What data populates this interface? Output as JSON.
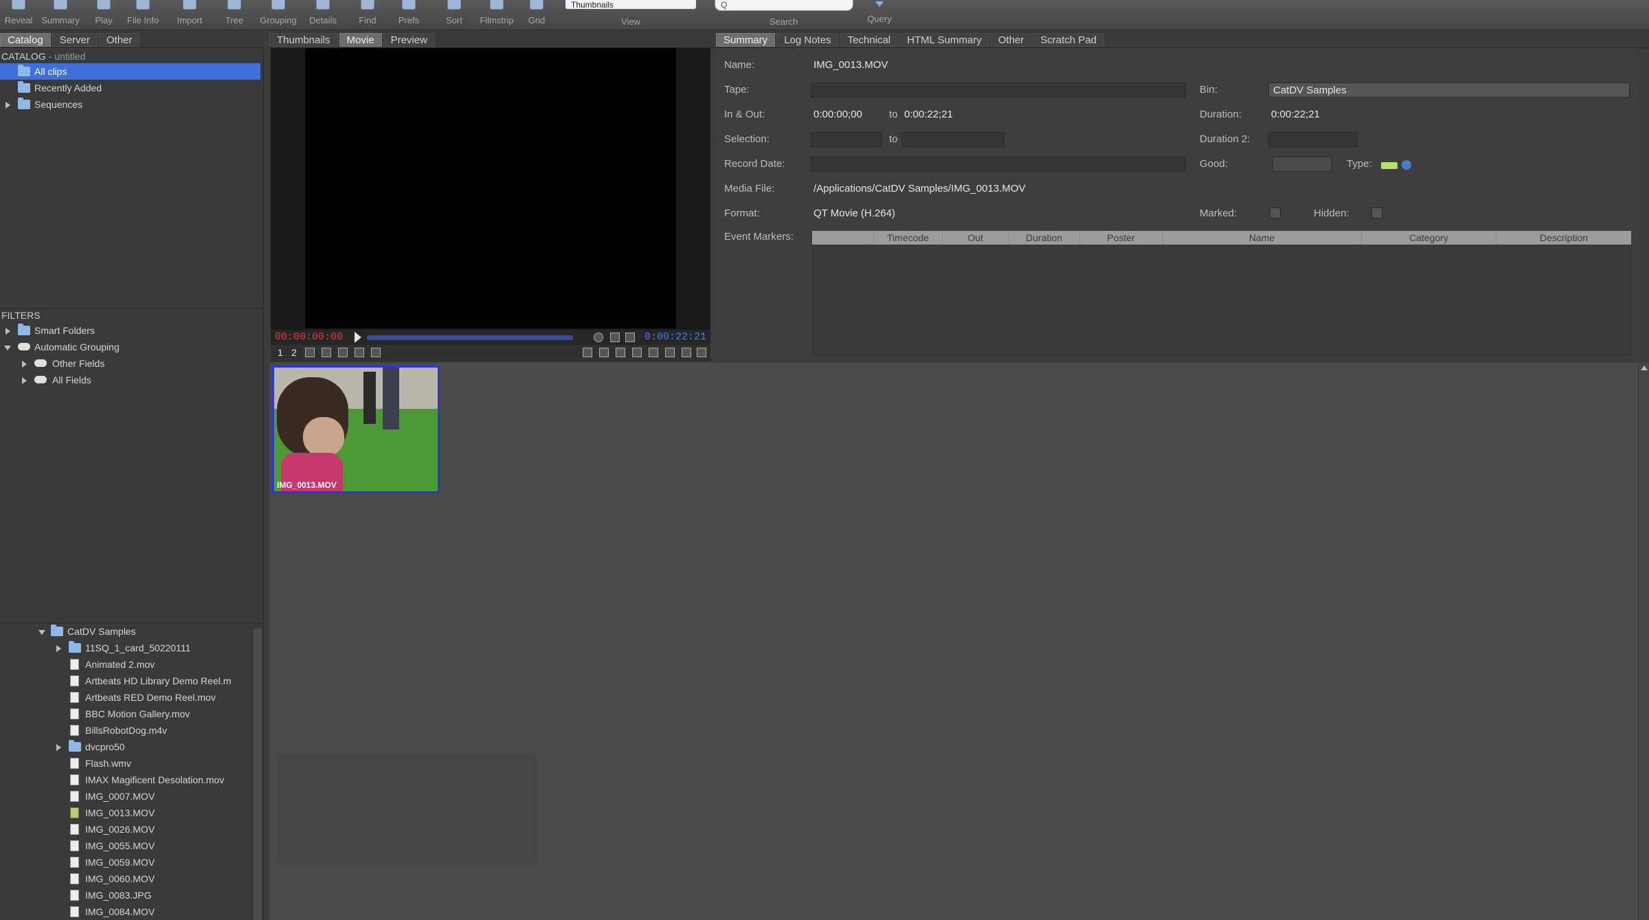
{
  "toolbar": {
    "buttons": [
      "Reveal",
      "Summary",
      "Play",
      "File Info",
      "Import",
      "Tree",
      "Grouping",
      "Details",
      "Find",
      "Prefs",
      "Sort",
      "Filmstrip",
      "Grid"
    ],
    "view_value": "Thumbnails",
    "view_label": "View",
    "search_placeholder": "Q",
    "search_label": "Search",
    "query_label": "Query"
  },
  "left_tabs": [
    "Catalog",
    "Server",
    "Other"
  ],
  "catalog": {
    "title": "CATALOG",
    "subtitle": " - untitled",
    "items": [
      "All clips",
      "Recently Added",
      "Sequences"
    ]
  },
  "filters": {
    "title": "FILTERS",
    "items": [
      "Smart Folders",
      "Automatic Grouping",
      "Other Fields",
      "All Fields"
    ]
  },
  "tree": {
    "root": "CatDV Samples",
    "items": [
      {
        "label": "11SQ_1_card_50220111",
        "kind": "folder"
      },
      {
        "label": "Animated 2.mov",
        "kind": "file"
      },
      {
        "label": "Artbeats HD Library Demo Reel.m",
        "kind": "file"
      },
      {
        "label": "Artbeats RED Demo Reel.mov",
        "kind": "file"
      },
      {
        "label": "BBC Motion Gallery.mov",
        "kind": "file"
      },
      {
        "label": "BillsRobotDog.m4v",
        "kind": "file"
      },
      {
        "label": "dvcpro50",
        "kind": "folder"
      },
      {
        "label": "Flash.wmv",
        "kind": "file"
      },
      {
        "label": "IMAX Magificent Desolation.mov",
        "kind": "file"
      },
      {
        "label": "IMG_0007.MOV",
        "kind": "file"
      },
      {
        "label": "IMG_0013.MOV",
        "kind": "clip"
      },
      {
        "label": "IMG_0026.MOV",
        "kind": "file"
      },
      {
        "label": "IMG_0055.MOV",
        "kind": "file"
      },
      {
        "label": "IMG_0059.MOV",
        "kind": "file"
      },
      {
        "label": "IMG_0060.MOV",
        "kind": "file"
      },
      {
        "label": "IMG_0083.JPG",
        "kind": "file"
      },
      {
        "label": "IMG_0084.MOV",
        "kind": "file"
      }
    ]
  },
  "viewer_tabs": [
    "Thumbnails",
    "Movie",
    "Preview"
  ],
  "viewer": {
    "tc_in": "00:00:00:00",
    "tc_out": "0:00:22:21",
    "marks": [
      "1",
      "2"
    ]
  },
  "info_tabs": [
    "Summary",
    "Log Notes",
    "Technical",
    "HTML Summary",
    "Other",
    "Scratch Pad"
  ],
  "summary": {
    "name_label": "Name:",
    "name": "IMG_0013.MOV",
    "tape_label": "Tape:",
    "bin_label": "Bin:",
    "bin": "CatDV Samples",
    "inout_label": "In & Out:",
    "in": "0:00:00;00",
    "to1": "to",
    "out": "0:00:22;21",
    "duration_label": "Duration:",
    "duration": "0:00:22;21",
    "selection_label": "Selection:",
    "to2": "to",
    "duration2_label": "Duration 2:",
    "record_date_label": "Record Date:",
    "good_label": "Good:",
    "type_label": "Type:",
    "media_file_label": "Media File:",
    "media_file": "/Applications/CatDV Samples/IMG_0013.MOV",
    "format_label": "Format:",
    "format": "QT Movie (H.264)",
    "marked_label": "Marked:",
    "hidden_label": "Hidden:",
    "event_markers_label": "Event Markers:",
    "marker_columns": [
      "",
      "Timecode",
      "Out",
      "Duration",
      "Poster",
      "Name",
      "Category",
      "Description"
    ]
  },
  "thumbnail": {
    "caption": "IMG_0013.MOV"
  }
}
